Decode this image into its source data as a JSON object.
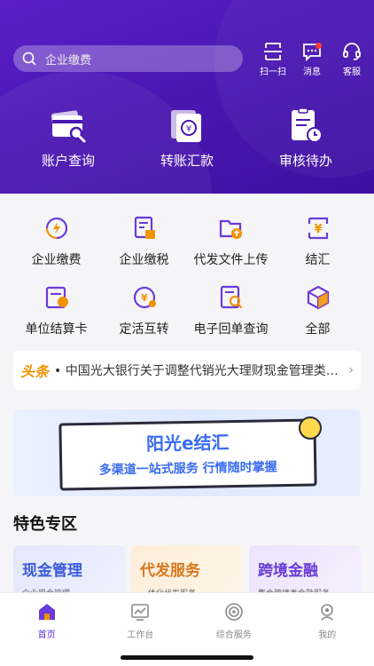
{
  "search": {
    "placeholder": "企业缴费"
  },
  "top_actions": [
    {
      "label": "扫一扫",
      "icon": "scan-icon"
    },
    {
      "label": "消息",
      "icon": "message-icon",
      "has_badge": true
    },
    {
      "label": "客服",
      "icon": "headset-icon"
    }
  ],
  "main_actions": [
    {
      "label": "账户查询",
      "icon": "account-query-icon"
    },
    {
      "label": "转账汇款",
      "icon": "transfer-icon"
    },
    {
      "label": "审核待办",
      "icon": "approval-icon"
    }
  ],
  "grid": [
    {
      "label": "企业缴费",
      "icon": "payment-icon"
    },
    {
      "label": "企业缴税",
      "icon": "tax-icon"
    },
    {
      "label": "代发文件上传",
      "icon": "file-upload-icon"
    },
    {
      "label": "结汇",
      "icon": "forex-settlement-icon"
    },
    {
      "label": "单位结算卡",
      "icon": "settlement-card-icon"
    },
    {
      "label": "定活互转",
      "icon": "deposit-transfer-icon"
    },
    {
      "label": "电子回单查询",
      "icon": "receipt-query-icon"
    },
    {
      "label": "全部",
      "icon": "all-icon"
    }
  ],
  "news": {
    "tag": "头条",
    "text": "• 中国光大银行关于调整代销光大理财现金管理类产品..."
  },
  "banner": {
    "title": "阳光e结汇",
    "subtitle": "多渠道一站式服务 行情随时掌握"
  },
  "featured": {
    "title": "特色专区",
    "cards": [
      {
        "title": "现金管理",
        "subtitle": "企业现金管理",
        "color": "#3b5bd9"
      },
      {
        "title": "代发服务",
        "subtitle": "一体化代发服务",
        "color": "#d9781f"
      },
      {
        "title": "跨境金融",
        "subtitle": "集合跨境类金融服务",
        "color": "#6a3bd9"
      }
    ]
  },
  "tabs": [
    {
      "label": "首页",
      "icon": "home-icon",
      "active": true
    },
    {
      "label": "工作台",
      "icon": "workbench-icon",
      "active": false
    },
    {
      "label": "综合服务",
      "icon": "services-icon",
      "active": false
    },
    {
      "label": "我的",
      "icon": "profile-icon",
      "active": false
    }
  ],
  "colors": {
    "header": "#4b17b3",
    "accent": "#5a2bd6",
    "icon_orange": "#f29200",
    "icon_purple": "#6a3bd9"
  }
}
